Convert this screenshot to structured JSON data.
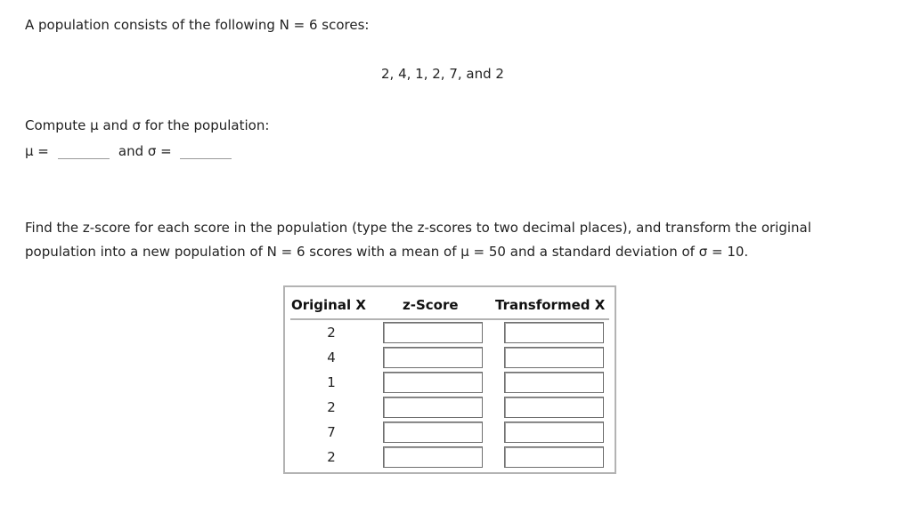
{
  "intro": "A population consists of the following N = 6 scores:",
  "scores_line": "2, 4, 1, 2, 7, and 2",
  "compute_prompt": "Compute μ and σ for the population:",
  "answers": {
    "mu_label": "μ =",
    "sigma_label": "and σ =",
    "mu_value": "",
    "sigma_value": ""
  },
  "instructions_line1": "Find the z-score for each score in the population (type the z-scores to two decimal places), and transform the original",
  "instructions_line2": "population into a new population of N = 6 scores with a mean of μ = 50 and a standard deviation of σ = 10.",
  "table": {
    "headers": [
      "Original X",
      "z-Score",
      "Transformed X"
    ],
    "rows": [
      {
        "x": "2",
        "z": "",
        "t": ""
      },
      {
        "x": "4",
        "z": "",
        "t": ""
      },
      {
        "x": "1",
        "z": "",
        "t": ""
      },
      {
        "x": "2",
        "z": "",
        "t": ""
      },
      {
        "x": "7",
        "z": "",
        "t": ""
      },
      {
        "x": "2",
        "z": "",
        "t": ""
      }
    ]
  }
}
